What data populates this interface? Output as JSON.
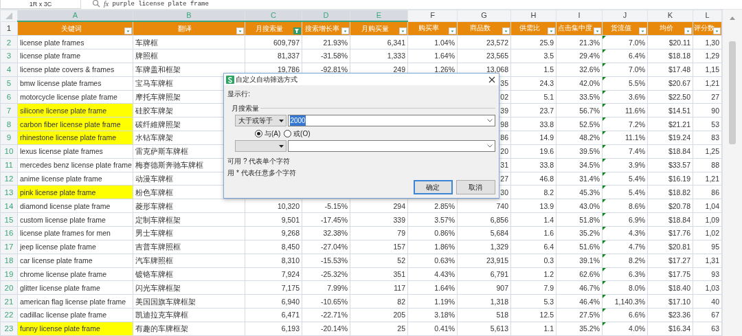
{
  "formula_bar": {
    "name_box": "1R x 3C",
    "function_label": "fx",
    "formula": "purple license plate frame"
  },
  "header_row_number": "1",
  "columns": [
    {
      "letter": "A",
      "header": "关键词",
      "selected": true,
      "filter_active": false,
      "flagged": false
    },
    {
      "letter": "B",
      "header": "翻译",
      "selected": true,
      "filter_active": false,
      "flagged": false
    },
    {
      "letter": "C",
      "header": "月搜索量",
      "selected": true,
      "filter_active": true,
      "flagged": false
    },
    {
      "letter": "D",
      "header": "搜索增长率",
      "selected": true,
      "filter_active": false,
      "flagged": false
    },
    {
      "letter": "E",
      "header": "月购买量",
      "selected": true,
      "filter_active": false,
      "flagged": false
    },
    {
      "letter": "F",
      "header": "购买率",
      "selected": false,
      "filter_active": false,
      "flagged": false
    },
    {
      "letter": "G",
      "header": "商品数",
      "selected": false,
      "filter_active": false,
      "flagged": false
    },
    {
      "letter": "H",
      "header": "供需比",
      "selected": false,
      "filter_active": false,
      "flagged": false
    },
    {
      "letter": "I",
      "header": "点击集中度",
      "selected": false,
      "filter_active": false,
      "flagged": false
    },
    {
      "letter": "J",
      "header": "货流值",
      "selected": false,
      "filter_active": false,
      "flagged": true
    },
    {
      "letter": "K",
      "header": "均价",
      "selected": false,
      "filter_active": false,
      "flagged": false
    },
    {
      "letter": "L",
      "header": "评分数",
      "selected": false,
      "filter_active": false,
      "flagged": false
    }
  ],
  "rows": [
    {
      "number": "2",
      "highlighted": false,
      "cells": [
        "license plate frames",
        "车牌框",
        "609,797",
        "21.93%",
        "6,341",
        "1.04%",
        "23,572",
        "25.9",
        "21.3%",
        "7.0%",
        "$20.11",
        "1,30"
      ]
    },
    {
      "number": "3",
      "highlighted": false,
      "cells": [
        "license plate frame",
        "牌照框",
        "81,337",
        "-31.58%",
        "1,333",
        "1.64%",
        "23,565",
        "3.5",
        "29.4%",
        "6.4%",
        "$18.18",
        "1,29"
      ]
    },
    {
      "number": "4",
      "highlighted": false,
      "cells": [
        "license plate covers & frames",
        "车牌盖和框架",
        "19,786",
        "-92.81%",
        "249",
        "1.26%",
        "13,068",
        "1.5",
        "32.6%",
        "7.0%",
        "$17.48",
        "1,15"
      ]
    },
    {
      "number": "5",
      "highlighted": false,
      "cells": [
        "bmw license plate frames",
        "宝马车牌框",
        null,
        null,
        null,
        null,
        "35",
        "24.3",
        "42.0%",
        "5.5%",
        "$20.67",
        "1,21"
      ]
    },
    {
      "number": "6",
      "highlighted": false,
      "cells": [
        "motorcycle license plate frame",
        "摩托车牌照架",
        null,
        null,
        null,
        null,
        "02",
        "5.1",
        "33.5%",
        "3.6%",
        "$22.50",
        "27"
      ]
    },
    {
      "number": "7",
      "highlighted": true,
      "cells": [
        "silicone license plate frame",
        "硅胶车牌架",
        null,
        null,
        null,
        null,
        "39",
        "23.7",
        "56.7%",
        "11.6%",
        "$14.51",
        "90"
      ]
    },
    {
      "number": "8",
      "highlighted": true,
      "cells": [
        "carbon fiber license plate frame",
        "碳纤維牌照架",
        null,
        null,
        null,
        null,
        "98",
        "33.8",
        "52.5%",
        "7.2%",
        "$21.21",
        "53"
      ]
    },
    {
      "number": "9",
      "highlighted": true,
      "cells": [
        "rhinestone license plate frame",
        "水钻车牌架",
        null,
        null,
        null,
        null,
        "86",
        "14.9",
        "48.2%",
        "11.1%",
        "$19.24",
        "83"
      ]
    },
    {
      "number": "10",
      "highlighted": false,
      "cells": [
        "lexus license plate frames",
        "雷克萨斯车牌框",
        null,
        null,
        null,
        null,
        "20",
        "19.6",
        "39.5%",
        "7.4%",
        "$18.84",
        "1,25"
      ]
    },
    {
      "number": "11",
      "highlighted": false,
      "cells": [
        "mercedes benz license plate frame",
        "梅赛德斯奔驰车牌框",
        null,
        null,
        null,
        null,
        "31",
        "33.8",
        "34.5%",
        "3.9%",
        "$33.57",
        "88"
      ]
    },
    {
      "number": "12",
      "highlighted": false,
      "cells": [
        "anime license plate frame",
        "动漫车牌框",
        null,
        null,
        null,
        null,
        "27",
        "46.8",
        "31.4%",
        "5.4%",
        "$16.19",
        "1,21"
      ]
    },
    {
      "number": "13",
      "highlighted": true,
      "cells": [
        "pink license plate frame",
        "粉色车牌框",
        null,
        null,
        null,
        null,
        "30",
        "8.2",
        "45.3%",
        "5.4%",
        "$18.82",
        "86"
      ]
    },
    {
      "number": "14",
      "highlighted": false,
      "cells": [
        "diamond license plate frame",
        "菱形车牌框",
        "10,320",
        "-5.15%",
        "294",
        "2.85%",
        "740",
        "13.9",
        "43.0%",
        "8.6%",
        "$20.78",
        "1,04"
      ]
    },
    {
      "number": "15",
      "highlighted": false,
      "cells": [
        "custom license plate frame",
        "定制车牌框架",
        "9,501",
        "-17.45%",
        "339",
        "3.57%",
        "6,856",
        "1.4",
        "51.8%",
        "6.9%",
        "$18.84",
        "1,09"
      ]
    },
    {
      "number": "16",
      "highlighted": false,
      "cells": [
        "license plate frames for men",
        "男士车牌框",
        "9,268",
        "32.38%",
        "79",
        "0.86%",
        "5,684",
        "1.6",
        "35.2%",
        "4.3%",
        "$17.76",
        "1,02"
      ]
    },
    {
      "number": "17",
      "highlighted": false,
      "cells": [
        "jeep license plate frame",
        "吉普车牌照框",
        "8,450",
        "-27.04%",
        "157",
        "1.86%",
        "1,329",
        "6.4",
        "51.6%",
        "4.7%",
        "$20.81",
        "95"
      ]
    },
    {
      "number": "18",
      "highlighted": false,
      "cells": [
        "car license plate frame",
        "汽车牌照框",
        "8,310",
        "-15.53%",
        "52",
        "0.63%",
        "23,915",
        "0.3",
        "39.1%",
        "8.2%",
        "$17.27",
        "1,31"
      ]
    },
    {
      "number": "19",
      "highlighted": false,
      "cells": [
        "chrome license plate frame",
        "镀铬车牌框",
        "7,924",
        "-25.32%",
        "351",
        "4.43%",
        "6,791",
        "1.2",
        "62.6%",
        "6.3%",
        "$17.75",
        "93"
      ]
    },
    {
      "number": "20",
      "highlighted": false,
      "cells": [
        "glitter license plate frame",
        "闪光车牌框架",
        "7,175",
        "7.99%",
        "117",
        "1.64%",
        "907",
        "7.9",
        "46.7%",
        "8.0%",
        "$18.40",
        "1,03"
      ]
    },
    {
      "number": "21",
      "highlighted": false,
      "cells": [
        "american flag license plate frame",
        "美国国旗车牌框架",
        "6,940",
        "-10.65%",
        "82",
        "1.19%",
        "1,318",
        "5.3",
        "46.4%",
        "1,140.3%",
        "$17.10",
        "40"
      ]
    },
    {
      "number": "22",
      "highlighted": false,
      "cells": [
        "cadillac license plate frame",
        "凯迪拉克车牌框",
        "6,471",
        "-22.71%",
        "205",
        "3.18%",
        "518",
        "12.5",
        "27.5%",
        "6.6%",
        "$23.36",
        "67"
      ]
    },
    {
      "number": "23",
      "highlighted": true,
      "cells": [
        "funny license plate frame",
        "有趣的车牌框架",
        "6,193",
        "-20.14%",
        "25",
        "0.41%",
        "5,613",
        "1.1",
        "35.2%",
        "4.0%",
        "$16.34",
        "63"
      ]
    }
  ],
  "dialog": {
    "title": "自定义自动筛选方式",
    "show_rows_label": "显示行:",
    "field_label": "月搜索量",
    "condition": {
      "operator": "大于或等于",
      "value": "2000"
    },
    "join_options": [
      {
        "label": "与(A)",
        "selected": true
      },
      {
        "label": "或(O)",
        "selected": false
      }
    ],
    "hints": [
      "可用 ? 代表单个字符",
      "用 * 代表任意多个字符"
    ],
    "buttons": [
      {
        "label": "确定",
        "default": true
      },
      {
        "label": "取消",
        "default": false
      }
    ]
  }
}
